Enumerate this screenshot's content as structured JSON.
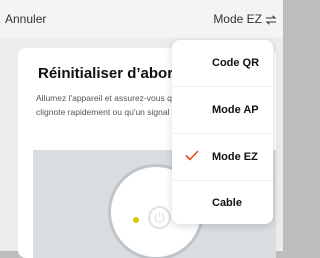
{
  "header": {
    "cancel_label": "Annuler",
    "mode_label": "Mode EZ"
  },
  "card": {
    "title": "Réinitialiser d’abord",
    "body": "Allumez l'appareil et assurez-vous que le voyant lumineux clignote rapidement ou qu'un signal sonore retentit."
  },
  "dropdown": {
    "items": [
      {
        "label": "Code QR",
        "selected": false
      },
      {
        "label": "Mode AP",
        "selected": false
      },
      {
        "label": "Mode EZ",
        "selected": true
      },
      {
        "label": "Cable",
        "selected": false
      }
    ]
  },
  "colors": {
    "check": "#f04a23",
    "led": "#d8c800"
  },
  "icons": {
    "mode_switch": "swap-arrows-icon",
    "selected": "checkmark-icon",
    "device_button": "power-icon"
  }
}
